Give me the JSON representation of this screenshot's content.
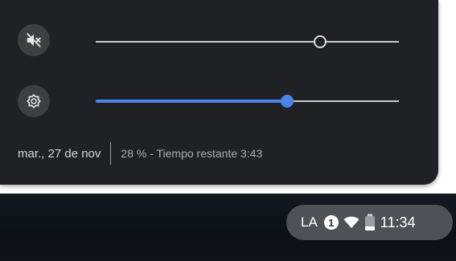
{
  "quick_settings": {
    "volume": {
      "icon": "volume-muted-icon",
      "level": 0.74,
      "muted": true
    },
    "brightness": {
      "icon": "brightness-icon",
      "level": 0.63
    },
    "date": "mar., 27 de nov",
    "battery_status": "28 % - Tiempo restante 3:43"
  },
  "shelf": {
    "ime_label": "LA",
    "notification_count": "1",
    "clock": "11:34",
    "wifi_icon": "wifi-icon",
    "battery_icon": "battery-icon"
  },
  "colors": {
    "panel_bg": "#202124",
    "accent": "#4c83e8",
    "tray_bg": "#4e5256"
  }
}
